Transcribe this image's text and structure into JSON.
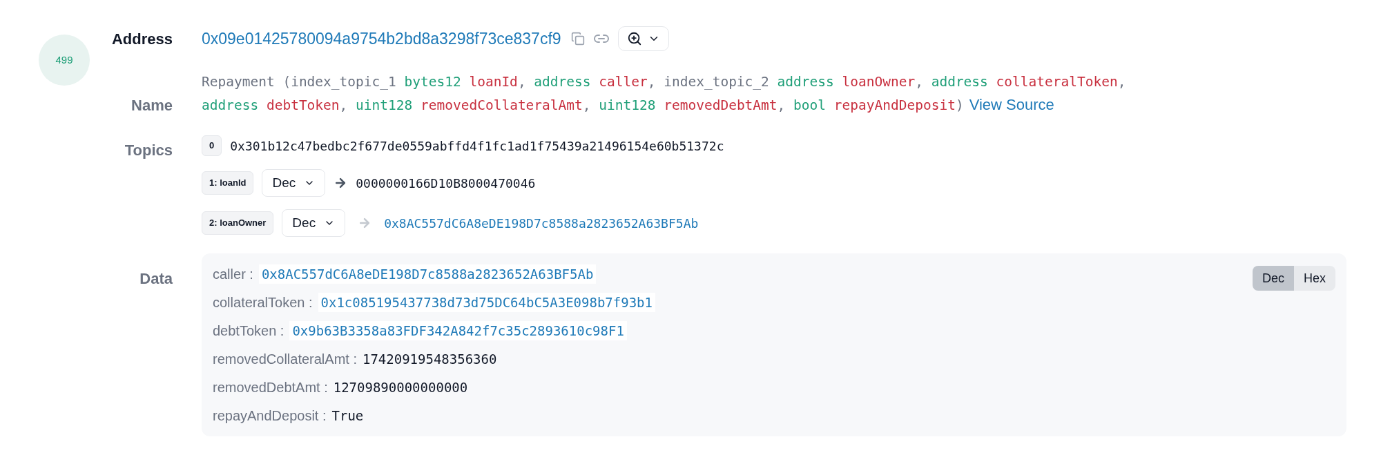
{
  "log_index": "499",
  "address": {
    "label": "Address",
    "value": "0x09e01425780094a9754b2bd8a3298f73ce837cf9"
  },
  "name": {
    "label": "Name",
    "lines": [
      [
        {
          "kind": "plain",
          "text": "Repayment (index_topic_1 "
        },
        {
          "kind": "type",
          "text": "bytes12 "
        },
        {
          "kind": "param",
          "text": "loanId"
        },
        {
          "kind": "plain",
          "text": ", "
        },
        {
          "kind": "type",
          "text": "address "
        },
        {
          "kind": "param",
          "text": "caller"
        },
        {
          "kind": "plain",
          "text": ", index_topic_2 "
        },
        {
          "kind": "type",
          "text": "address "
        },
        {
          "kind": "param",
          "text": "loanOwner"
        },
        {
          "kind": "plain",
          "text": ", "
        },
        {
          "kind": "type",
          "text": "address "
        },
        {
          "kind": "param",
          "text": "collateralToken"
        },
        {
          "kind": "plain",
          "text": ","
        }
      ],
      [
        {
          "kind": "type",
          "text": "address "
        },
        {
          "kind": "param",
          "text": "debtToken"
        },
        {
          "kind": "plain",
          "text": ", "
        },
        {
          "kind": "type",
          "text": "uint128 "
        },
        {
          "kind": "param",
          "text": "removedCollateralAmt"
        },
        {
          "kind": "plain",
          "text": ", "
        },
        {
          "kind": "type",
          "text": "uint128 "
        },
        {
          "kind": "param",
          "text": "removedDebtAmt"
        },
        {
          "kind": "plain",
          "text": ", "
        },
        {
          "kind": "type",
          "text": "bool "
        },
        {
          "kind": "param",
          "text": "repayAndDeposit"
        },
        {
          "kind": "plain",
          "text": ")"
        }
      ]
    ],
    "link": "View Source"
  },
  "topics": {
    "label": "Topics",
    "rows": [
      {
        "kind": "raw",
        "tag": "0",
        "value": "0x301b12c47bedbc2f677de0559abffd4f1fc1ad1f75439a21496154e60b51372c"
      },
      {
        "kind": "text",
        "tag": "1: loanId",
        "format": "Dec",
        "value": "0000000166D10B8000470046"
      },
      {
        "kind": "address",
        "tag": "2: loanOwner",
        "format": "Dec",
        "value": "0x8AC557dC6A8eDE198D7c8588a2823652A63BF5Ab"
      }
    ]
  },
  "data": {
    "label": "Data",
    "toggle": [
      {
        "label": "Dec",
        "selected": true
      },
      {
        "label": "Hex",
        "selected": false
      }
    ],
    "fields": [
      {
        "kind": "address",
        "name": "caller :",
        "value": "0x8AC557dC6A8eDE198D7c8588a2823652A63BF5Ab"
      },
      {
        "kind": "address",
        "name": "collateralToken :",
        "value": "0x1c085195437738d73d75DC64bC5A3E098b7f93b1"
      },
      {
        "kind": "address",
        "name": "debtToken :",
        "value": "0x9b63B3358a83FDF342A842f7c35c2893610c98F1"
      },
      {
        "kind": "text",
        "name": "removedCollateralAmt :",
        "value": "17420919548356360"
      },
      {
        "kind": "text",
        "name": "removedDebtAmt :",
        "value": "12709890000000000"
      },
      {
        "kind": "text",
        "name": "repayAndDeposit :",
        "value": "True"
      }
    ]
  }
}
